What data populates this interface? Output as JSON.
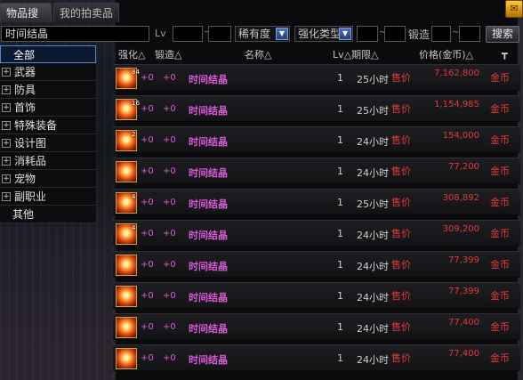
{
  "tabs": [
    {
      "label": "物品搜索"
    },
    {
      "label": "我的拍卖品"
    }
  ],
  "filters": {
    "search_value": "时间结晶",
    "lv_label": "Lv",
    "lv_min": "",
    "lv_max": "",
    "rarity_label": "稀有度",
    "enhance_type_label": "强化类型",
    "enhance_min": "",
    "enhance_max": "",
    "forge_label": "锻造",
    "forge_min": "",
    "forge_max": "",
    "search_button": "搜索",
    "tilde": "~"
  },
  "sidebar": {
    "items": [
      {
        "label": "全部",
        "expandable": false,
        "selected": true
      },
      {
        "label": "武器",
        "expandable": true
      },
      {
        "label": "防具",
        "expandable": true
      },
      {
        "label": "首饰",
        "expandable": true
      },
      {
        "label": "特殊装备",
        "expandable": true
      },
      {
        "label": "设计图",
        "expandable": true
      },
      {
        "label": "消耗品",
        "expandable": true
      },
      {
        "label": "宠物",
        "expandable": true
      },
      {
        "label": "副职业",
        "expandable": true
      },
      {
        "label": "其他",
        "expandable": false
      }
    ]
  },
  "table": {
    "headers": {
      "enhance": "强化△",
      "forge": "锻造△",
      "name": "名称△",
      "lv_period": "Lv△期限△",
      "price": "价格(金币)△"
    },
    "rows": [
      {
        "badge": "84",
        "enhance": "+0",
        "forge": "+0",
        "name": "时间结晶",
        "lv": "1",
        "time": "25小时",
        "price_label": "售价",
        "price": "7,162,800",
        "unit": "金币"
      },
      {
        "badge": "16",
        "enhance": "+0",
        "forge": "+0",
        "name": "时间结晶",
        "lv": "1",
        "time": "25小时",
        "price_label": "售价",
        "price": "1,154,985",
        "unit": "金币"
      },
      {
        "badge": "2",
        "enhance": "+0",
        "forge": "+0",
        "name": "时间结晶",
        "lv": "1",
        "time": "24小时",
        "price_label": "售价",
        "price": "154,000",
        "unit": "金币"
      },
      {
        "badge": "",
        "enhance": "+0",
        "forge": "+0",
        "name": "时间结晶",
        "lv": "1",
        "time": "24小时",
        "price_label": "售价",
        "price": "77,200",
        "unit": "金币"
      },
      {
        "badge": "4",
        "enhance": "+0",
        "forge": "+0",
        "name": "时间结晶",
        "lv": "1",
        "time": "25小时",
        "price_label": "售价",
        "price": "308,892",
        "unit": "金币"
      },
      {
        "badge": "4",
        "enhance": "+0",
        "forge": "+0",
        "name": "时间结晶",
        "lv": "1",
        "time": "24小时",
        "price_label": "售价",
        "price": "309,200",
        "unit": "金币"
      },
      {
        "badge": "",
        "enhance": "+0",
        "forge": "+0",
        "name": "时间结晶",
        "lv": "1",
        "time": "24小时",
        "price_label": "售价",
        "price": "77,399",
        "unit": "金币"
      },
      {
        "badge": "",
        "enhance": "+0",
        "forge": "+0",
        "name": "时间结晶",
        "lv": "1",
        "time": "24小时",
        "price_label": "售价",
        "price": "77,399",
        "unit": "金币"
      },
      {
        "badge": "",
        "enhance": "+0",
        "forge": "+0",
        "name": "时间结晶",
        "lv": "1",
        "time": "24小时",
        "price_label": "售价",
        "price": "77,400",
        "unit": "金币"
      },
      {
        "badge": "",
        "enhance": "+0",
        "forge": "+0",
        "name": "时间结晶",
        "lv": "1",
        "time": "24小时",
        "price_label": "售价",
        "price": "77,400",
        "unit": "金币"
      }
    ]
  },
  "icons": {
    "item": "time-crystal-icon",
    "pin": "pin-icon",
    "corner": "mail-icon"
  },
  "colors": {
    "item_name": "#d85ad8",
    "price": "#e03a3a",
    "selected_border": "#4b8ad8"
  }
}
